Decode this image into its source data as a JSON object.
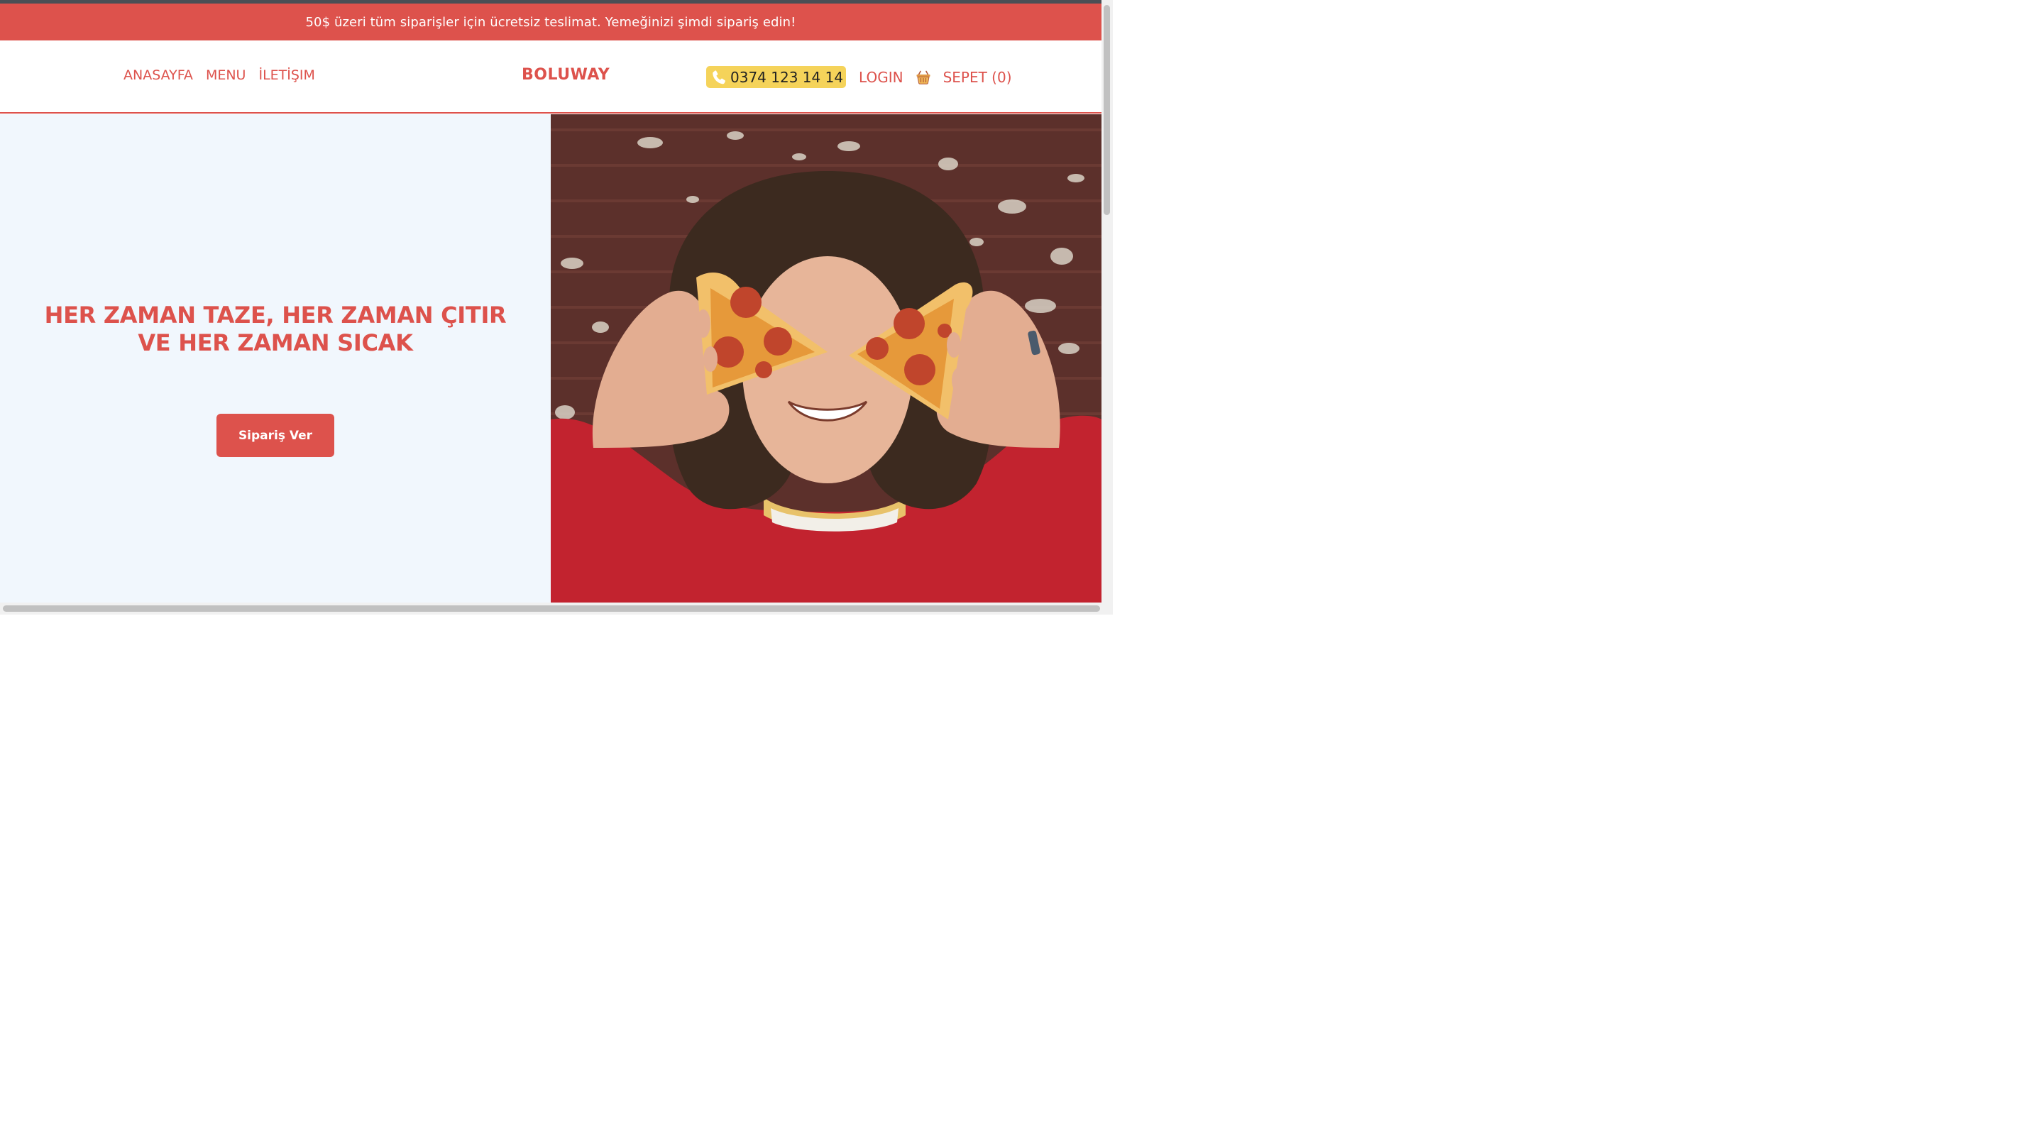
{
  "announcement": {
    "text": "50$ üzeri tüm siparişler için ücretsiz teslimat. Yemeğinizi şimdi sipariş edin!"
  },
  "nav": {
    "links": [
      "ANASAYFA",
      "MENU",
      "İLETİŞIM"
    ],
    "brand": "BOLUWAY",
    "phone": "0374 123 14 14",
    "login": "LOGIN",
    "cart": "SEPET (0)"
  },
  "hero": {
    "title": "HER ZAMAN TAZE, HER ZAMAN ÇITIR VE HER ZAMAN SICAK",
    "button": "Sipariş Ver"
  },
  "colors": {
    "brand_red": "#dd524c",
    "phone_yellow": "#f5d35a",
    "hero_bg": "#f1f7fd"
  },
  "icons": {
    "phone": "phone-icon",
    "cart": "basket-icon"
  }
}
